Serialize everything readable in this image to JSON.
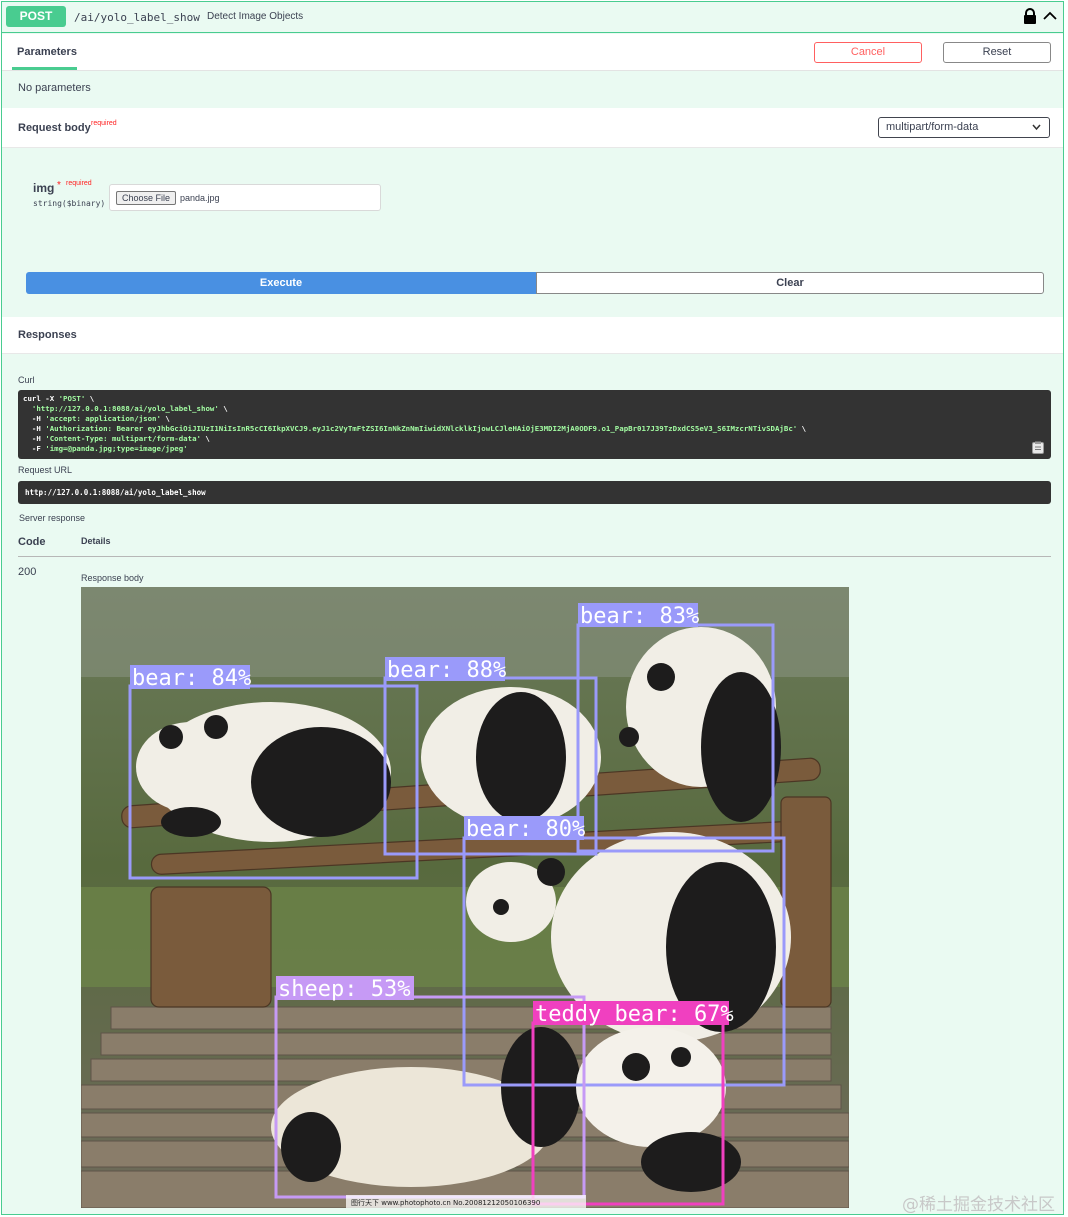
{
  "summary": {
    "method": "POST",
    "path": "/ai/yolo_label_show",
    "description": "Detect Image Objects"
  },
  "tabs": {
    "parameters": "Parameters",
    "cancel": "Cancel",
    "reset": "Reset"
  },
  "parameters": {
    "empty_text": "No parameters"
  },
  "request_body": {
    "title": "Request body",
    "required": "required",
    "content_type": "multipart/form-data",
    "param": {
      "name": "img",
      "star": "*",
      "required": "required",
      "type": "string($binary)",
      "choose_label": "Choose File",
      "file_name": "panda.jpg"
    }
  },
  "actions": {
    "execute": "Execute",
    "clear": "Clear"
  },
  "responses": {
    "title": "Responses",
    "curl_label": "Curl",
    "curl_lines": [
      [
        "curl -X ",
        "'POST'",
        " \\"
      ],
      [
        "  ",
        "'http://127.0.0.1:8088/ai/yolo_label_show'",
        " \\"
      ],
      [
        "  -H ",
        "'accept: application/json'",
        " \\"
      ],
      [
        "  -H ",
        "'Authorization: Bearer eyJhbGciOiJIUzI1NiIsInR5cCI6IkpXVCJ9.eyJ1c2VyTmFtZSI6InNkZnNmIiwidXNlcklkIjowLCJleHAiOjE3MDI2MjA0ODF9.o1_PapBr017J39TzDxdCS5eV3_S6IMzcrNTivSDAjBc'",
        " \\"
      ],
      [
        "  -H ",
        "'Content-Type: multipart/form-data'",
        " \\"
      ],
      [
        "  -F ",
        "'img=@panda.jpg;type=image/jpeg'",
        ""
      ]
    ],
    "request_url_label": "Request URL",
    "request_url": "http://127.0.0.1:8088/ai/yolo_label_show",
    "server_response_label": "Server response",
    "code_header": "Code",
    "details_header": "Details",
    "code": "200",
    "response_body_label": "Response body",
    "detections": [
      {
        "label": "bear: 83%",
        "color": "#9a9afa"
      },
      {
        "label": "bear: 84%",
        "color": "#9a9afa"
      },
      {
        "label": "bear: 88%",
        "color": "#9a9afa"
      },
      {
        "label": "bear: 80%",
        "color": "#9a9afa"
      },
      {
        "label": "sheep: 53%",
        "color": "#c69af5"
      },
      {
        "label": "teddy bear: 67%",
        "color": "#f040c0"
      }
    ],
    "image_caption": "图行天下 www.photophoto.cn No.20081212050106390"
  },
  "watermark": "@稀土掘金技术社区",
  "colors": {
    "post": "#49cc90",
    "execute": "#4990e2",
    "cancel": "#ff6060",
    "bg": "#eafaf2"
  }
}
